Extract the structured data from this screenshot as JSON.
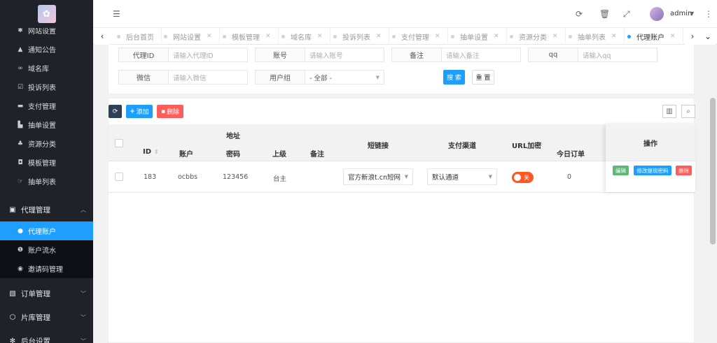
{
  "sidebar": {
    "items": [
      {
        "label": "网站设置",
        "icon": "gear-icon"
      },
      {
        "label": "通知公告",
        "icon": "bell-icon"
      },
      {
        "label": "域名库",
        "icon": "link-icon"
      },
      {
        "label": "投诉列表",
        "icon": "checkbox-icon"
      },
      {
        "label": "支付管理",
        "icon": "card-icon"
      },
      {
        "label": "抽单设置",
        "icon": "chart-icon"
      },
      {
        "label": "资源分类",
        "icon": "tree-icon"
      },
      {
        "label": "模板管理",
        "icon": "shield-icon"
      },
      {
        "label": "抽单列表",
        "icon": "hand-icon"
      }
    ],
    "group_agent": "代理管理",
    "agent_items": [
      {
        "label": "代理账户",
        "icon": "user-icon"
      },
      {
        "label": "账户流水",
        "icon": "coin-icon"
      },
      {
        "label": "邀请码管理",
        "icon": "eye-icon"
      }
    ],
    "group_order": "订单管理",
    "group_library": "片库管理",
    "group_backend": "后台设置"
  },
  "topbar": {
    "username": "admin"
  },
  "tabs": [
    {
      "label": "后台首页"
    },
    {
      "label": "网站设置"
    },
    {
      "label": "模板管理"
    },
    {
      "label": "域名库"
    },
    {
      "label": "投诉列表"
    },
    {
      "label": "支付管理"
    },
    {
      "label": "抽单设置"
    },
    {
      "label": "资源分类"
    },
    {
      "label": "抽单列表"
    },
    {
      "label": "代理账户"
    }
  ],
  "search": {
    "agent_id_label": "代理ID",
    "agent_id_placeholder": "请输入代理ID",
    "account_label": "账号",
    "account_placeholder": "请输入账号",
    "remark_label": "备注",
    "remark_placeholder": "请输入备注",
    "qq_label": "qq",
    "qq_placeholder": "请输入qq",
    "wechat_label": "微信",
    "wechat_placeholder": "请输入微信",
    "group_label": "用户组",
    "group_selected": "- 全部 -",
    "search_button": "搜 索",
    "reset_button": "重 置"
  },
  "toolbar": {
    "add_label": "添加",
    "delete_label": "删除"
  },
  "table": {
    "header_address": "地址",
    "col_id": "ID",
    "col_account": "账户",
    "col_password": "密码",
    "col_parent": "上级",
    "col_remark": "备注",
    "col_shortlink": "短链接",
    "col_payment": "支付渠道",
    "col_url_encrypt": "URL加密",
    "col_today_orders": "今日订单",
    "col_actions": "操作",
    "rows": [
      {
        "id": "183",
        "account": "ocbbs",
        "password": "123456",
        "parent": "台主",
        "remark": "",
        "shortlink": "官方新浪t.cn短网",
        "payment": "默认通道",
        "url_encrypt": "关",
        "today_orders": "0"
      }
    ],
    "edit_label": "编辑",
    "change_pwd_label": "修改提现密码",
    "delete_row_label": "删除"
  },
  "colors": {
    "primary": "#1e9fff",
    "sidebar": "#20222a",
    "danger": "#ff5722",
    "success": "#5fb878"
  }
}
